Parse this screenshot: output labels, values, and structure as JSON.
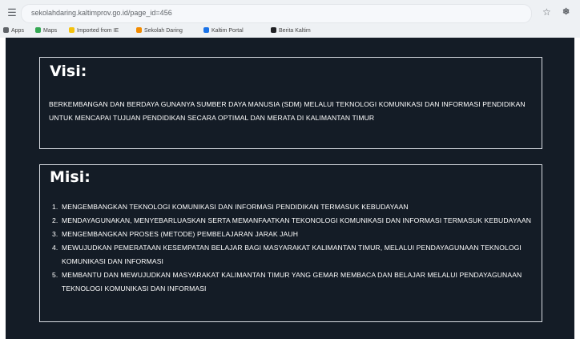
{
  "browser": {
    "url": "sekolahdaring.kaltimprov.go.id/page_id=456",
    "bookmarks": [
      {
        "label": "Apps",
        "color": "#5f6368"
      },
      {
        "label": "Maps",
        "color": "#34a853"
      },
      {
        "label": "Imported from IE",
        "color": "#f4c20d"
      },
      {
        "label": "Sekolah Daring",
        "color": "#f28b00"
      },
      {
        "label": "Kaltim Portal",
        "color": "#1a73e8"
      },
      {
        "label": "Berita Kaltim",
        "color": "#202124"
      }
    ]
  },
  "visi": {
    "title": "Visi:",
    "text": "BERKEMBANGAN DAN BERDAYA GUNANYA SUMBER DAYA MANUSIA (SDM) MELALUI TEKNOLOGI KOMUNIKASI DAN INFORMASI PENDIDIKAN UNTUK MENCAPAI TUJUAN PENDIDIKAN SECARA OPTIMAL DAN MERATA DI KALIMANTAN TIMUR"
  },
  "misi": {
    "title": "Misi:",
    "items": [
      {
        "num": "1.",
        "text": "MENGEMBANGKAN TEKNOLOGI KOMUNIKASI DAN INFORMASI PENDIDIKAN TERMASUK KEBUDAYAAN"
      },
      {
        "num": "2.",
        "text": "MENDAYAGUNAKAN, MENYEBARLUASKAN SERTA MEMANFAATKAN TEKONOLOGI KOMUNIKASI DAN INFORMASI TERMASUK KEBUDAYAAN"
      },
      {
        "num": "3.",
        "text": "MENGEMBANGKAN PROSES (METODE) PEMBELAJARAN JARAK JAUH"
      },
      {
        "num": "4.",
        "text": "MEWUJUDKAN PEMERATAAN KESEMPATAN BELAJAR BAGI MASYARAKAT KALIMANTAN TIMUR, MELALUI PENDAYAGUNAAN TEKNOLOGI KOMUNIKASI DAN INFORMASI"
      },
      {
        "num": "5.",
        "text": "MEMBANTU DAN MEWUJUDKAN MASYARAKAT KALIMANTAN TIMUR YANG GEMAR MEMBACA DAN BELAJAR MELALUI PENDAYAGUNAAN TEKNOLOGI KOMUNIKASI DAN INFORMASI"
      }
    ]
  }
}
